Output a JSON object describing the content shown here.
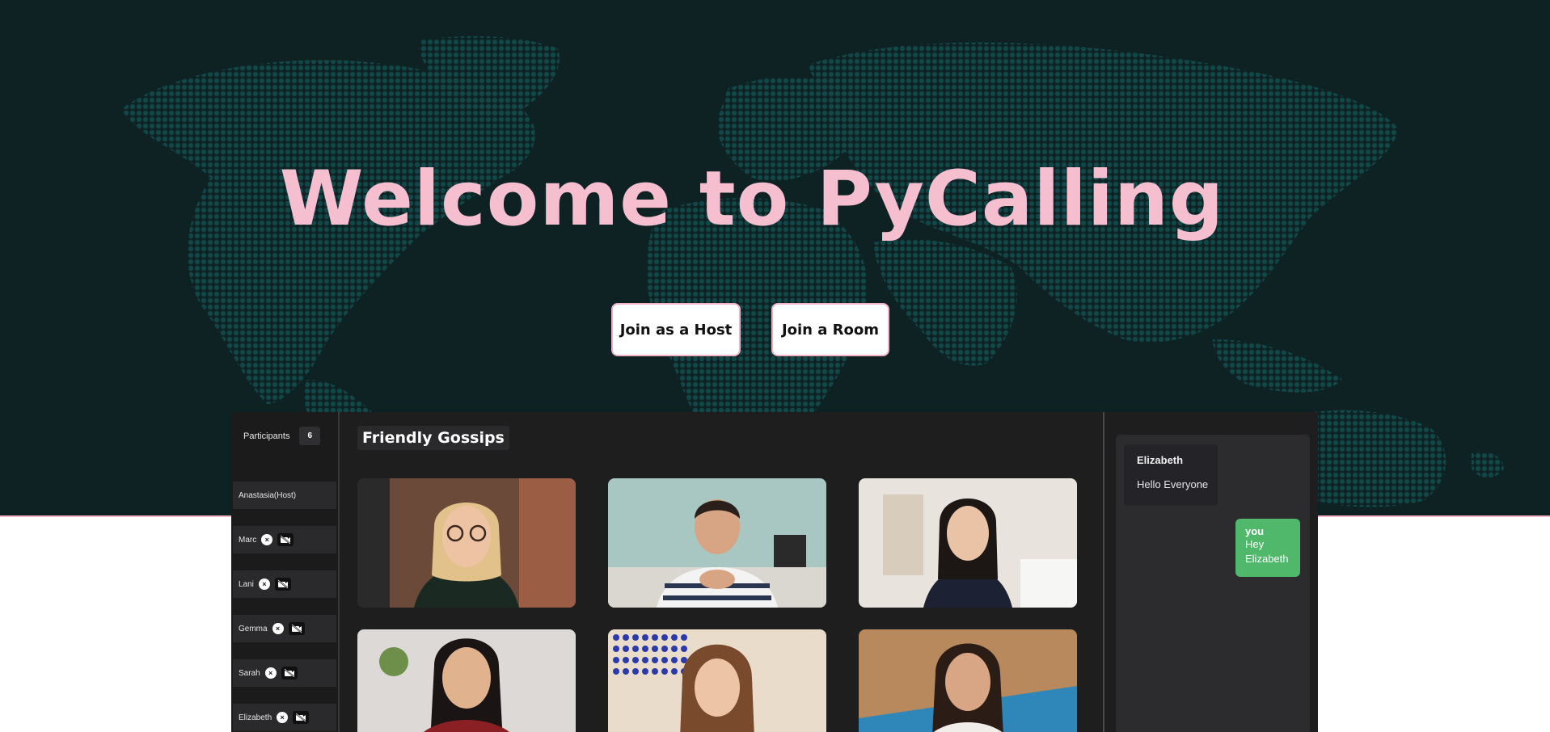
{
  "hero": {
    "title": "Welcome to PyCalling",
    "join_host_label": "Join as a Host",
    "join_room_label": "Join a Room"
  },
  "app": {
    "participants_label": "Participants",
    "participants_count": "6",
    "participants": [
      {
        "name": "Anastasia(Host)",
        "is_host": true
      },
      {
        "name": "Marc"
      },
      {
        "name": "Lani"
      },
      {
        "name": "Gemma"
      },
      {
        "name": "Sarah"
      },
      {
        "name": "Elizabeth"
      }
    ],
    "room_title": "Friendly Gossips",
    "chat": {
      "incoming": {
        "author": "Elizabeth",
        "text": "Hello Everyone"
      },
      "outgoing": {
        "author": "you",
        "text": "Hey Elizabeth"
      }
    }
  },
  "colors": {
    "hero_bg": "#0e2224",
    "map_dots": "#12474a",
    "title_pink": "#f6bfcf",
    "app_bg": "#1e1e1f",
    "outgoing_bubble": "#4fb86a"
  },
  "icons": [
    "remove-participant-icon",
    "camera-off-icon"
  ]
}
